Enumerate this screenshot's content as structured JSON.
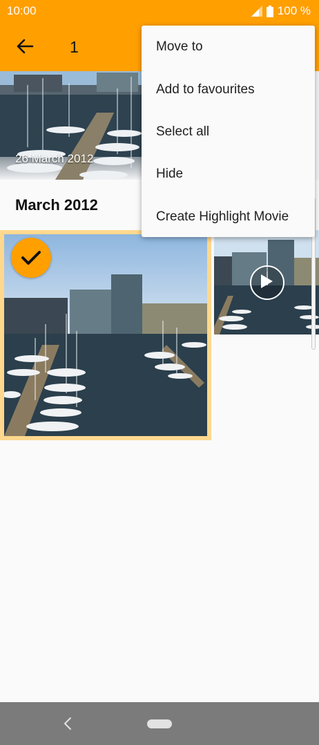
{
  "status_bar": {
    "time": "10:00",
    "battery": "100 %"
  },
  "app_bar": {
    "selection_count": "1"
  },
  "hero": {
    "date": "26 March 2012"
  },
  "section": {
    "title": "March 2012"
  },
  "menu": {
    "items": [
      {
        "label": "Move to"
      },
      {
        "label": "Add to favourites"
      },
      {
        "label": "Select all"
      },
      {
        "label": "Hide"
      },
      {
        "label": "Create Highlight Movie"
      }
    ]
  },
  "colors": {
    "accent": "#ff9f00",
    "selection_border": "#ffd88e",
    "nav_bar": "#7b7b7b"
  },
  "icons": [
    "signal-icon",
    "battery-icon",
    "back-arrow-icon",
    "checkmark-icon",
    "play-icon",
    "nav-back-icon",
    "nav-home-pill"
  ]
}
